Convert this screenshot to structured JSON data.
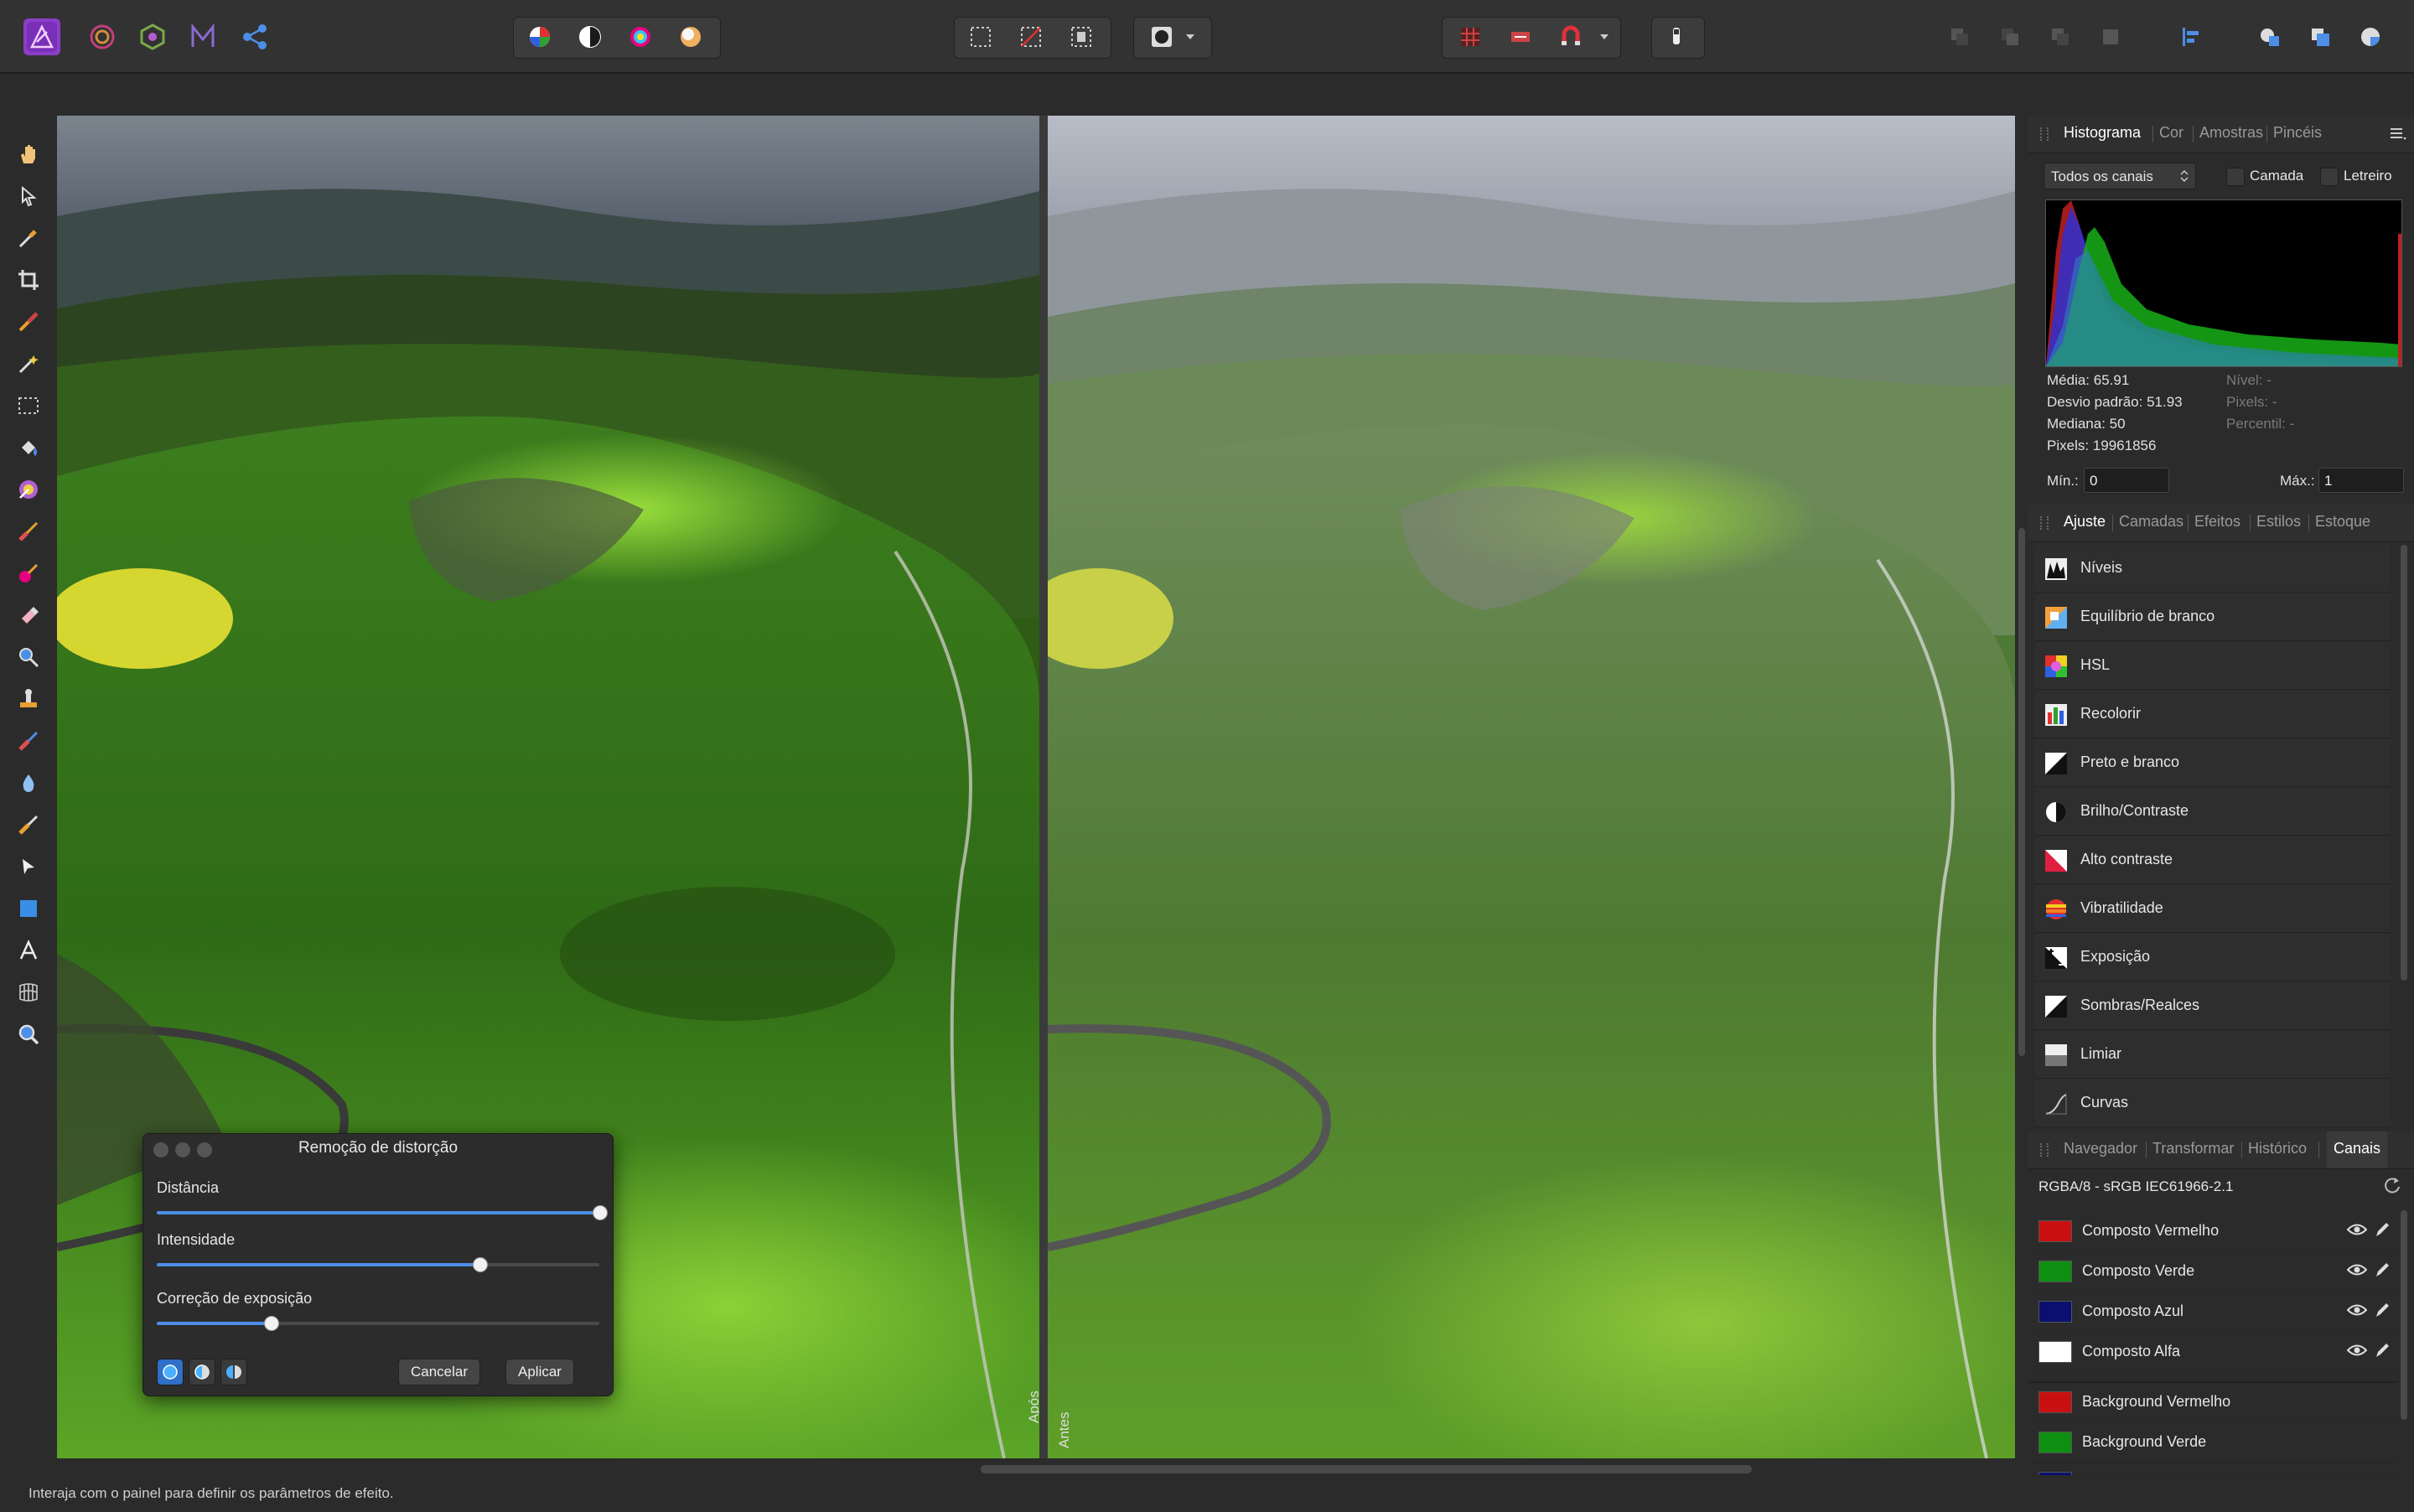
{
  "toolbar": {
    "personas": [
      "photo-persona-icon",
      "liquify-persona-icon",
      "develop-persona-icon",
      "tone-mapping-persona-icon",
      "export-persona-icon"
    ],
    "accent": "#9b59d0"
  },
  "canvas": {
    "after_label": "Após",
    "before_label": "Antes"
  },
  "dialog": {
    "title": "Remoção de distorção",
    "sliders": [
      {
        "label": "Distância",
        "value": 1.0
      },
      {
        "label": "Intensidade",
        "value": 0.73
      },
      {
        "label": "Correção de exposição",
        "value": 0.25
      }
    ],
    "cancel_label": "Cancelar",
    "apply_label": "Aplicar"
  },
  "histogram_panel": {
    "tabs": [
      "Histograma",
      "Cor",
      "Amostras",
      "Pincéis"
    ],
    "active_tab": "Histograma",
    "channel_select": "Todos os canais",
    "layer_checkbox": "Camada",
    "marquee_checkbox": "Letreiro",
    "stats": {
      "mean": "Média: 65.91",
      "stddev": "Desvio padrão: 51.93",
      "median": "Mediana: 50",
      "pixels": "Pixels: 19961856",
      "level": "Nível: -",
      "pixels_r": "Pixels: -",
      "percentile": "Percentil: -"
    },
    "min_label": "Mín.:",
    "min_value": "0",
    "max_label": "Máx.:",
    "max_value": "1"
  },
  "adjust_panel": {
    "tabs": [
      "Ajuste",
      "Camadas",
      "Efeitos",
      "Estilos",
      "Estoque"
    ],
    "active_tab": "Ajuste",
    "items": [
      {
        "label": "Níveis",
        "icon": "levels-icon"
      },
      {
        "label": "Equilíbrio de branco",
        "icon": "white-balance-icon"
      },
      {
        "label": "HSL",
        "icon": "hsl-icon"
      },
      {
        "label": "Recolorir",
        "icon": "recolor-icon"
      },
      {
        "label": "Preto e branco",
        "icon": "black-white-icon"
      },
      {
        "label": "Brilho/Contraste",
        "icon": "brightness-contrast-icon"
      },
      {
        "label": "Alto contraste",
        "icon": "high-contrast-icon"
      },
      {
        "label": "Vibratilidade",
        "icon": "vibrance-icon"
      },
      {
        "label": "Exposição",
        "icon": "exposure-icon"
      },
      {
        "label": "Sombras/Realces",
        "icon": "shadows-highlights-icon"
      },
      {
        "label": "Limiar",
        "icon": "threshold-icon"
      },
      {
        "label": "Curvas",
        "icon": "curves-icon"
      }
    ]
  },
  "channels_panel": {
    "tabs": [
      "Navegador",
      "Transformar",
      "Histórico",
      "Canais"
    ],
    "active_tab": "Canais",
    "profile": "RGBA/8 - sRGB IEC61966-2.1",
    "channels": [
      {
        "label": "Composto Vermelho",
        "color": "#c81010"
      },
      {
        "label": "Composto Verde",
        "color": "#0f8f12"
      },
      {
        "label": "Composto Azul",
        "color": "#0b1070"
      },
      {
        "label": "Composto Alfa",
        "color": "#ffffff"
      },
      {
        "label": "Background Vermelho",
        "color": "#c81010"
      },
      {
        "label": "Background Verde",
        "color": "#0f8f12"
      }
    ]
  },
  "status": {
    "text": "Interaja com o painel para definir os parâmetros de efeito."
  }
}
